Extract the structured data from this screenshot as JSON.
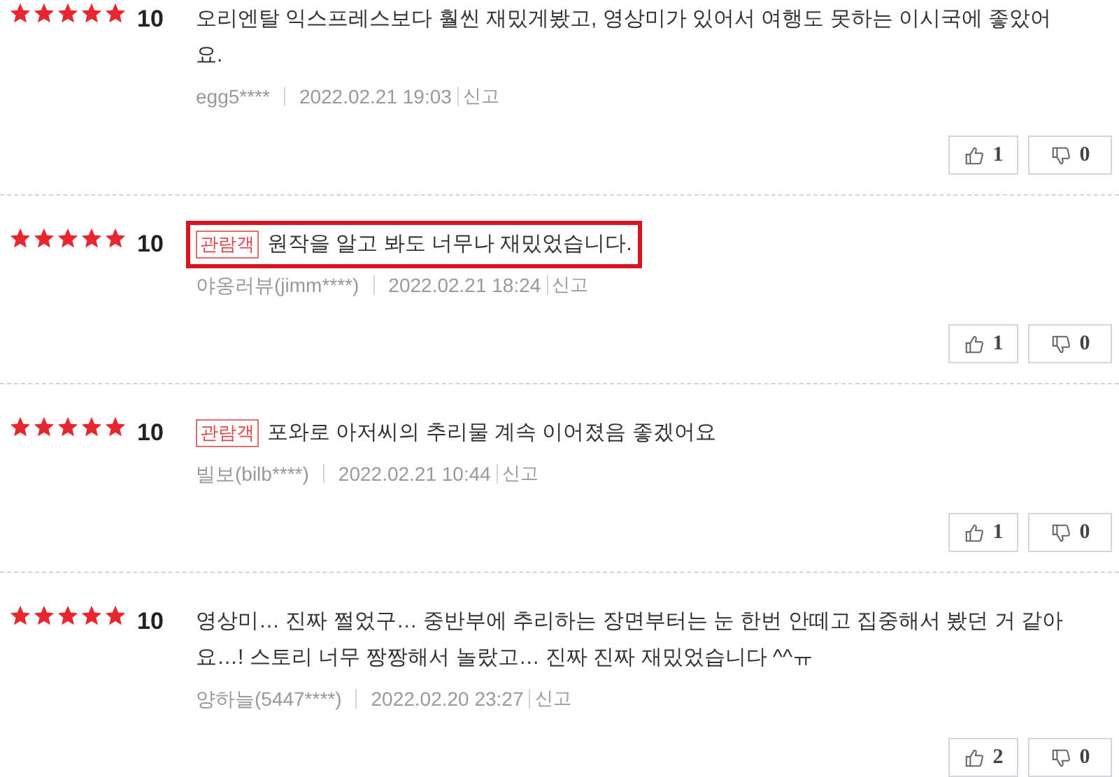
{
  "reviews": [
    {
      "stars": 5,
      "score": "10",
      "highlighted": false,
      "text": "오리엔탈 익스프레스보다 훨씬 재밌게봤고, 영상미가 있어서 여행도 못하는 이시국에 좋았어요.",
      "author": "egg5****",
      "date": "2022.02.21 19:03",
      "report": "신고",
      "likes": "1",
      "dislikes": "0"
    },
    {
      "stars": 5,
      "score": "10",
      "highlighted": true,
      "badge": "관람객",
      "text": "원작을 알고 봐도 너무나 재밌었습니다.",
      "author": "야옹러뷰(jimm****)",
      "date": "2022.02.21 18:24",
      "report": "신고",
      "likes": "1",
      "dislikes": "0"
    },
    {
      "stars": 5,
      "score": "10",
      "highlighted": false,
      "badge": "관람객",
      "text": "포와로 아저씨의 추리물 계속 이어졌음 좋겠어요",
      "author": "빌보(bilb****)",
      "date": "2022.02.21 10:44",
      "report": "신고",
      "likes": "1",
      "dislikes": "0"
    },
    {
      "stars": 5,
      "score": "10",
      "highlighted": false,
      "text": "영상미… 진짜 쩔었구… 중반부에 추리하는 장면부터는 눈 한번 안떼고 집중해서 봤던 거 같아요…! 스토리 너무 짱짱해서 놀랐고… 진짜 진짜 재밌었습니다 ^^ㅠ",
      "author": "양하늘(5447****)",
      "date": "2022.02.20 23:27",
      "report": "신고",
      "likes": "2",
      "dislikes": "0"
    }
  ]
}
